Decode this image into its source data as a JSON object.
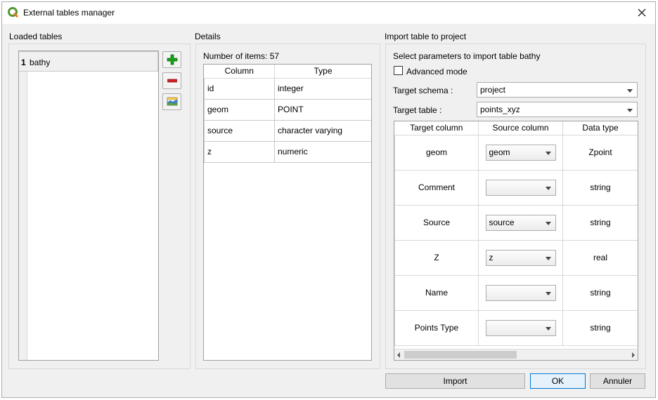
{
  "window": {
    "title": "External tables manager"
  },
  "loaded_tables": {
    "label": "Loaded tables",
    "rows": [
      {
        "num": "1",
        "name": "bathy"
      }
    ]
  },
  "details": {
    "label": "Details",
    "count_text": "Number of items: 57",
    "headers": [
      "Column",
      "Type"
    ],
    "rows": [
      [
        "id",
        "integer"
      ],
      [
        "geom",
        "POINT"
      ],
      [
        "source",
        "character varying"
      ],
      [
        "z",
        "numeric"
      ]
    ]
  },
  "import": {
    "label": "Import table to project",
    "params_text": "Select parameters to import table bathy",
    "advanced_mode_label": "Advanced mode",
    "target_schema_label": "Target schema :",
    "target_schema_value": "project",
    "target_table_label": "Target table :",
    "target_table_value": "points_xyz",
    "headers": [
      "Target column",
      "Source column",
      "Data type"
    ],
    "rows": [
      {
        "target": "geom",
        "source": "geom",
        "type": "Zpoint"
      },
      {
        "target": "Comment",
        "source": "",
        "type": "string"
      },
      {
        "target": "Source",
        "source": "source",
        "type": "string"
      },
      {
        "target": "Z",
        "source": "z",
        "type": "real"
      },
      {
        "target": "Name",
        "source": "",
        "type": "string"
      },
      {
        "target": "Points Type",
        "source": "",
        "type": "string"
      }
    ]
  },
  "buttons": {
    "import": "Import",
    "ok": "OK",
    "cancel": "Annuler"
  },
  "colors": {
    "add": "#19a019",
    "remove": "#d01e1e",
    "qgis": "#589632"
  },
  "icons": {
    "app": "qgis-icon",
    "close": "close-icon",
    "add": "plus-icon",
    "remove": "minus-icon",
    "load": "table-load-icon"
  }
}
